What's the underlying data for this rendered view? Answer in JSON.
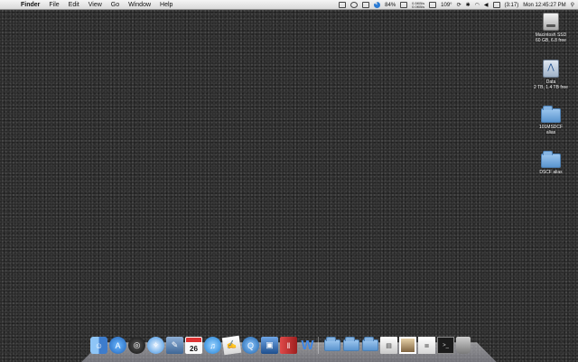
{
  "menubar": {
    "app_name": "Finder",
    "menus": [
      "File",
      "Edit",
      "View",
      "Go",
      "Window",
      "Help"
    ],
    "status": {
      "battery_percent": "84%",
      "network_rate": "0.5KB/s\n0.0KB/s",
      "temperature": "109°",
      "battery_time": "(3:17)",
      "clock": "Mon 12:45:27 PM"
    }
  },
  "desktop": {
    "icons": [
      {
        "name": "Macintosh SSD",
        "sub": "60 GB, 6.8 free",
        "kind": "internal-disk"
      },
      {
        "name": "Data",
        "sub": "2 TB, 1.4 TB free",
        "kind": "external-disk"
      },
      {
        "name": "101MSDCF",
        "sub": "alias",
        "kind": "folder-alias"
      },
      {
        "name": "DSCF alias",
        "sub": "",
        "kind": "folder-alias"
      }
    ]
  },
  "dock": {
    "calendar_day": "26",
    "items": [
      {
        "name": "finder-icon",
        "color": "#4a90e2"
      },
      {
        "name": "app-store-icon",
        "color": "#2a7ad3"
      },
      {
        "name": "dashboard-icon",
        "color": "#333333"
      },
      {
        "name": "safari-icon",
        "color": "#3b8fe0"
      },
      {
        "name": "preview-icon",
        "color": "#6b8db5"
      },
      {
        "name": "calendar-icon",
        "color": "#ffffff"
      },
      {
        "name": "itunes-icon",
        "color": "#1f7fd6"
      },
      {
        "name": "textedit-icon",
        "color": "#f2f2f2"
      },
      {
        "name": "quicktime-icon",
        "color": "#1b5fa8"
      },
      {
        "name": "screen-sharing-icon",
        "color": "#2d6fb8"
      },
      {
        "name": "flashcards-icon",
        "color": "#c33131"
      },
      {
        "name": "word-icon",
        "color": "#2f69c2"
      },
      {
        "name": "applications-folder-icon",
        "color": "#8fb8df"
      },
      {
        "name": "documents-folder-icon",
        "color": "#8fb8df"
      },
      {
        "name": "downloads-folder-icon",
        "color": "#8fb8df"
      },
      {
        "name": "newspaper-stack-icon",
        "color": "#d9d9d9"
      },
      {
        "name": "photos-stack-icon",
        "color": "#b88f5a"
      },
      {
        "name": "documents-stack-icon",
        "color": "#e8e8e8"
      },
      {
        "name": "terminal-stack-icon",
        "color": "#222222"
      },
      {
        "name": "trash-icon",
        "color": "#a0a0a0"
      }
    ]
  }
}
